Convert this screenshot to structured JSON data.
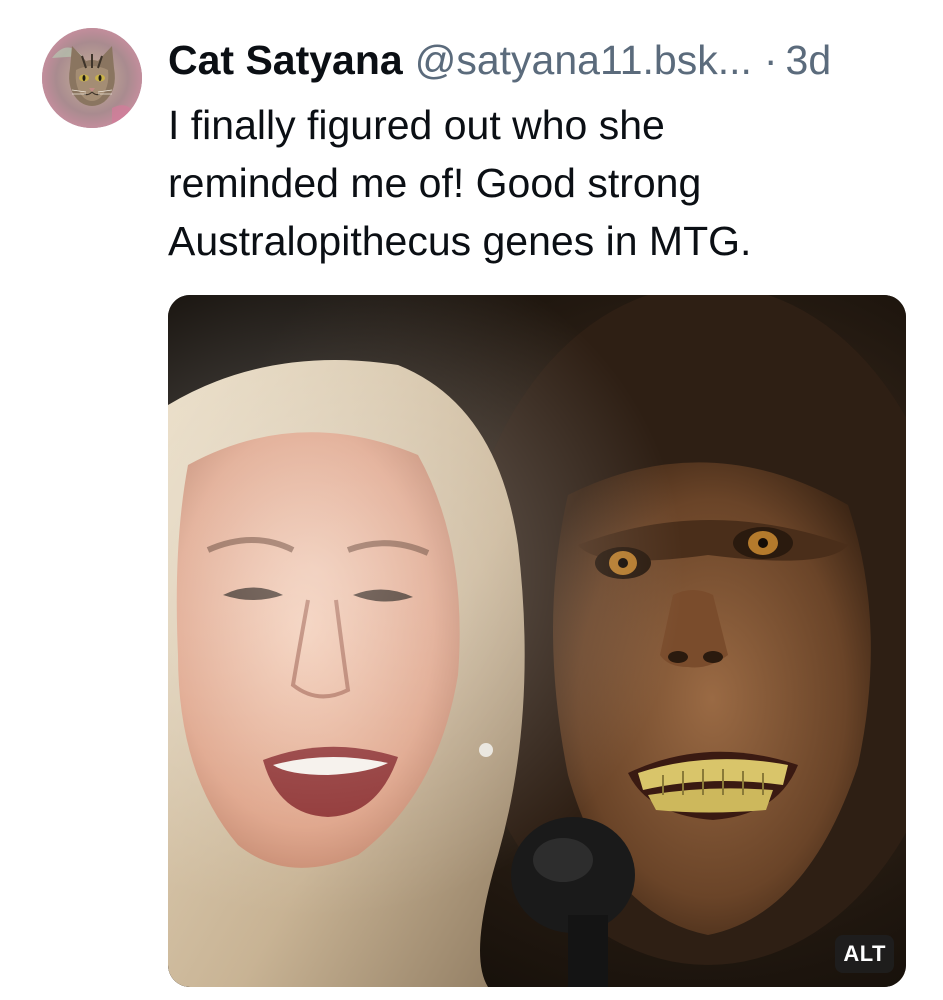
{
  "post": {
    "author_name": "Cat Satyana",
    "author_handle": "@satyana11.bsk...",
    "separator": "·",
    "timestamp": "3d",
    "text": "I finally figured out who she\nreminded me of!  Good strong\nAustralopithecus genes in MTG.",
    "avatar_icon": "cat-avatar-icon",
    "media": {
      "alt_label": "ALT",
      "image_description_icon": "photo-composite-image"
    }
  }
}
